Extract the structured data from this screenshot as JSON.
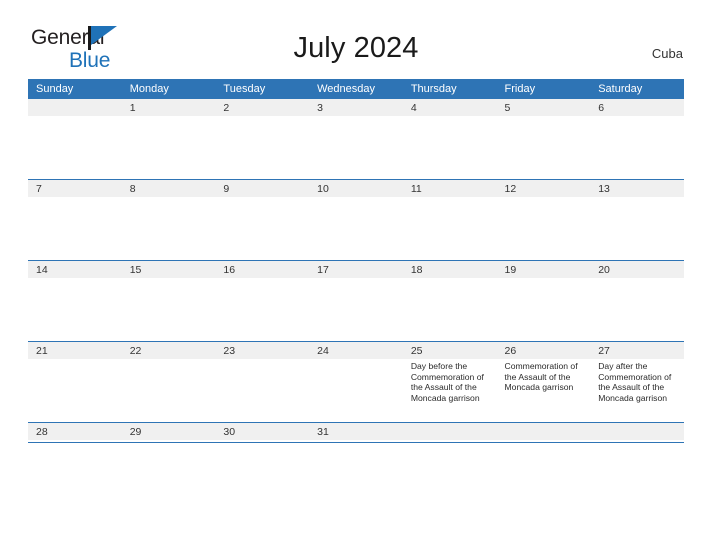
{
  "brand": {
    "line1": "General",
    "line2": "Blue",
    "flag_icon": "blue-flag-triangle-icon",
    "accent_color": "#1f72b8"
  },
  "header": {
    "title": "July 2024",
    "locale": "Cuba"
  },
  "theme": {
    "header_blue": "#2e74b5",
    "band_gray": "#f0f0f0",
    "text_dark": "#333333"
  },
  "calendar": {
    "weekdays": [
      "Sunday",
      "Monday",
      "Tuesday",
      "Wednesday",
      "Thursday",
      "Friday",
      "Saturday"
    ],
    "weeks": [
      [
        {
          "day": "",
          "events": []
        },
        {
          "day": "1",
          "events": []
        },
        {
          "day": "2",
          "events": []
        },
        {
          "day": "3",
          "events": []
        },
        {
          "day": "4",
          "events": []
        },
        {
          "day": "5",
          "events": []
        },
        {
          "day": "6",
          "events": []
        }
      ],
      [
        {
          "day": "7",
          "events": []
        },
        {
          "day": "8",
          "events": []
        },
        {
          "day": "9",
          "events": []
        },
        {
          "day": "10",
          "events": []
        },
        {
          "day": "11",
          "events": []
        },
        {
          "day": "12",
          "events": []
        },
        {
          "day": "13",
          "events": []
        }
      ],
      [
        {
          "day": "14",
          "events": []
        },
        {
          "day": "15",
          "events": []
        },
        {
          "day": "16",
          "events": []
        },
        {
          "day": "17",
          "events": []
        },
        {
          "day": "18",
          "events": []
        },
        {
          "day": "19",
          "events": []
        },
        {
          "day": "20",
          "events": []
        }
      ],
      [
        {
          "day": "21",
          "events": []
        },
        {
          "day": "22",
          "events": []
        },
        {
          "day": "23",
          "events": []
        },
        {
          "day": "24",
          "events": []
        },
        {
          "day": "25",
          "events": [
            "Day before the Commemoration of the Assault of the Moncada garrison"
          ]
        },
        {
          "day": "26",
          "events": [
            "Commemoration of the Assault of the Moncada garrison"
          ]
        },
        {
          "day": "27",
          "events": [
            "Day after the Commemoration of the Assault of the Moncada garrison"
          ]
        }
      ],
      [
        {
          "day": "28",
          "events": []
        },
        {
          "day": "29",
          "events": []
        },
        {
          "day": "30",
          "events": []
        },
        {
          "day": "31",
          "events": []
        },
        {
          "day": "",
          "events": []
        },
        {
          "day": "",
          "events": []
        },
        {
          "day": "",
          "events": []
        }
      ]
    ]
  }
}
